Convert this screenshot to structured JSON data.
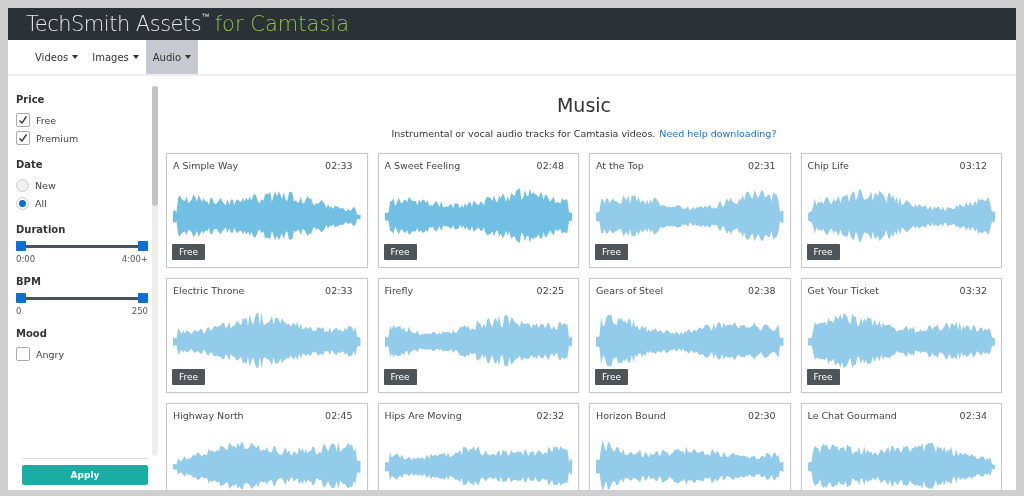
{
  "header": {
    "brand": "TechSmith Assets",
    "trademark": "™",
    "product": "for Camtasia"
  },
  "nav": [
    {
      "label": "Videos",
      "selected": false
    },
    {
      "label": "Images",
      "selected": false
    },
    {
      "label": "Audio",
      "selected": true
    }
  ],
  "sidebar": {
    "sections": [
      {
        "kind": "checkbox",
        "title": "Price",
        "options": [
          {
            "label": "Free",
            "checked": true
          },
          {
            "label": "Premium",
            "checked": true
          }
        ]
      },
      {
        "kind": "radio",
        "title": "Date",
        "options": [
          {
            "label": "New",
            "selected": false
          },
          {
            "label": "All",
            "selected": true
          }
        ]
      },
      {
        "kind": "range",
        "title": "Duration",
        "min_label": "0:00",
        "max_label": "4:00+",
        "thumbs": [
          {
            "level": 0
          },
          {
            "level": 1
          }
        ]
      },
      {
        "kind": "range",
        "title": "BPM",
        "min_label": "0",
        "max_label": "250",
        "thumbs": [
          {
            "level": 0
          },
          {
            "level": 1
          }
        ]
      },
      {
        "kind": "checkbox",
        "title": "Mood",
        "options": [
          {
            "label": "Angry",
            "checked": false
          }
        ]
      }
    ],
    "apply": "Apply"
  },
  "page": {
    "title": "Music",
    "intro": "Instrumental or vocal audio tracks for Camtasia videos.",
    "help_link": "Need help downloading?"
  },
  "tracks": [
    {
      "title": "A Simple Way",
      "duration": "02:33",
      "badge": "Free"
    },
    {
      "title": "A Sweet Feeling",
      "duration": "02:48",
      "badge": "Free"
    },
    {
      "title": "At the Top",
      "duration": "02:31",
      "badge": "Free"
    },
    {
      "title": "Chip Life",
      "duration": "03:12",
      "badge": "Free"
    },
    {
      "title": "Electric Throne",
      "duration": "02:33",
      "badge": "Free"
    },
    {
      "title": "Firefly",
      "duration": "02:25",
      "badge": "Free"
    },
    {
      "title": "Gears of Steel",
      "duration": "02:38",
      "badge": "Free"
    },
    {
      "title": "Get Your Ticket",
      "duration": "03:32",
      "badge": "Free"
    },
    {
      "title": "Highway North",
      "duration": "02:45"
    },
    {
      "title": "Hips Are Moving",
      "duration": "02:32"
    },
    {
      "title": "Horizon Bound",
      "duration": "02:30"
    },
    {
      "title": "Le Chat Gourmand",
      "duration": "02:34"
    }
  ]
}
